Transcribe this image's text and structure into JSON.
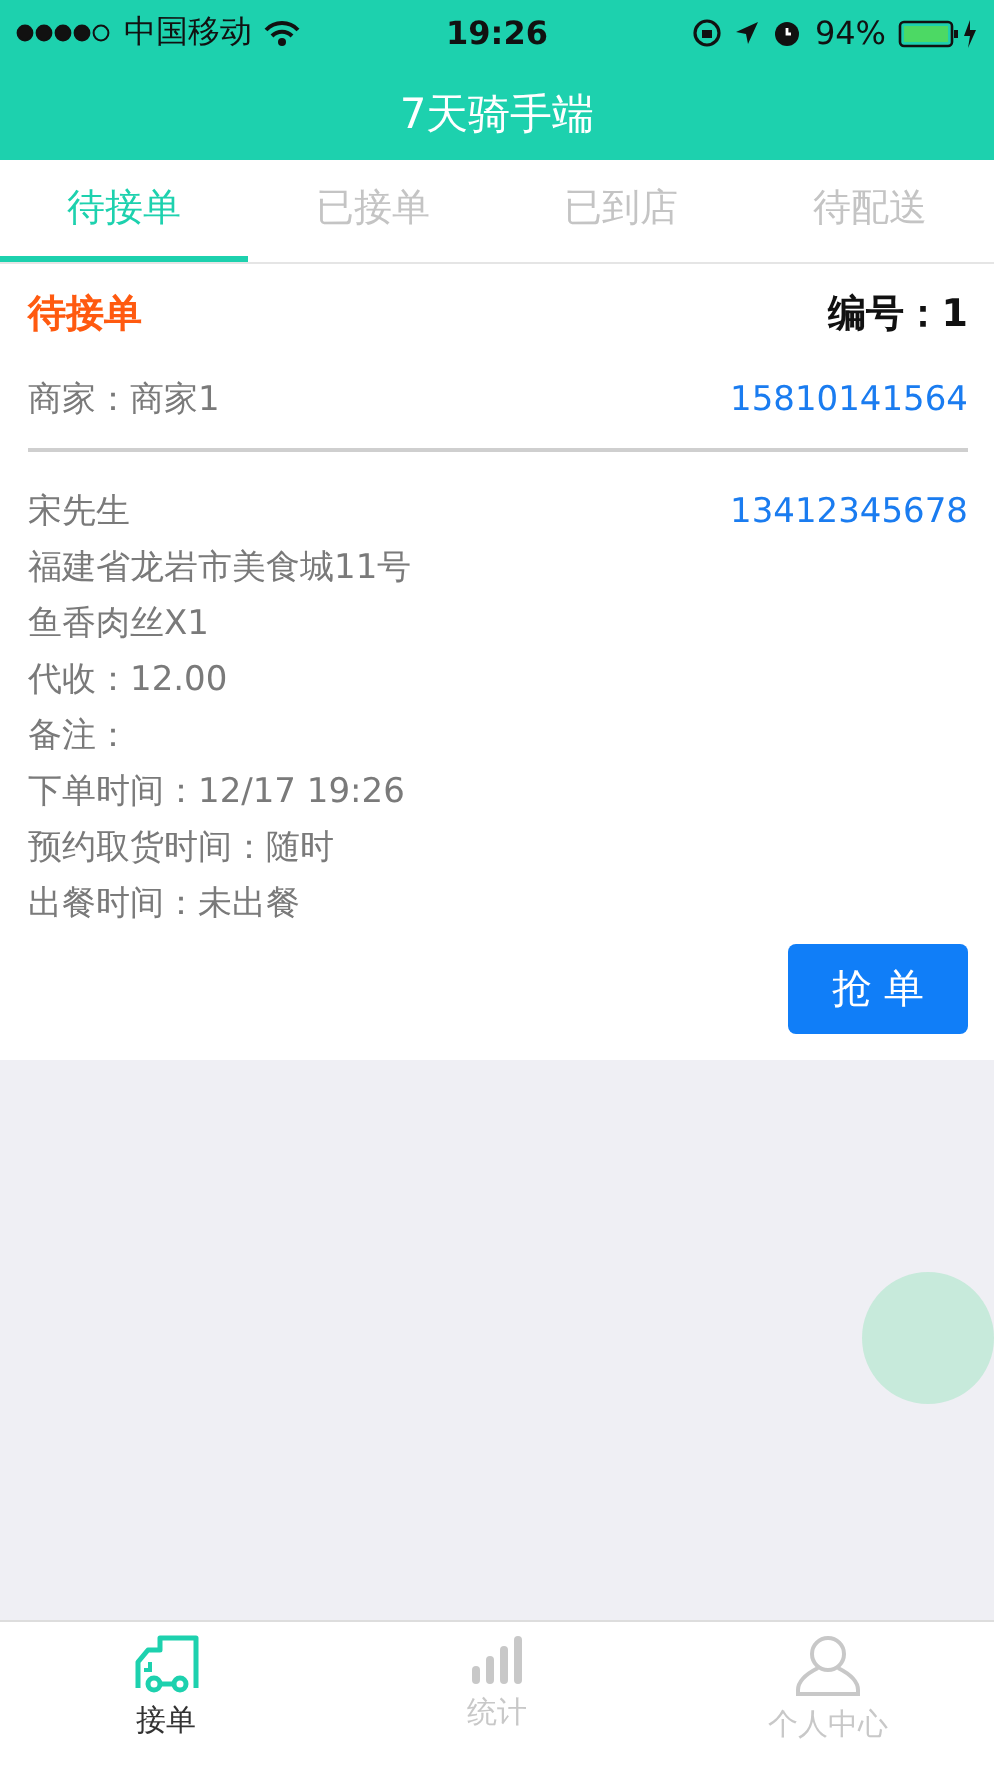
{
  "status_bar": {
    "carrier": "中国移动",
    "time": "19:26",
    "battery": "94%"
  },
  "nav": {
    "title": "7天骑手端"
  },
  "tabs": [
    {
      "label": "待接单",
      "selected": true
    },
    {
      "label": "已接单",
      "selected": false
    },
    {
      "label": "已到店",
      "selected": false
    },
    {
      "label": "待配送",
      "selected": false
    }
  ],
  "order": {
    "status": "待接单",
    "number": "编号：1",
    "merchant": "商家：商家1",
    "merchant_phone": "15810141564",
    "customer": "宋先生",
    "customer_phone": "13412345678",
    "details": [
      "福建省龙岩市美食城11号",
      "鱼香肉丝X1",
      "代收：12.00",
      "备注：",
      "下单时间：12/17 19:26",
      "预约取货时间：随时",
      "出餐时间：未出餐"
    ],
    "action": "抢 单"
  },
  "tab_bar": [
    {
      "label": "接单",
      "kind": "truck",
      "selected": true
    },
    {
      "label": "统计",
      "kind": "bars",
      "selected": false
    },
    {
      "label": "个人中心",
      "kind": "person",
      "selected": false
    }
  ]
}
